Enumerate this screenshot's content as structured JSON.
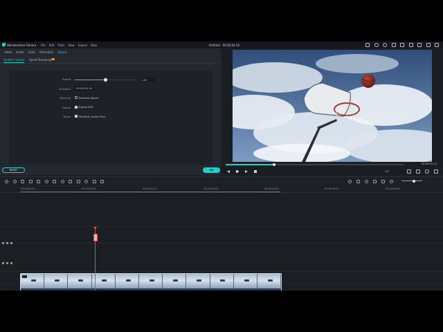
{
  "app": {
    "name": "Wondershare Filmora",
    "menus": [
      "File",
      "Edit",
      "Tools",
      "View",
      "Export",
      "Help"
    ],
    "document_title": "Untitled : 00:00:04:16"
  },
  "panel": {
    "tabs": [
      "Video",
      "Audio",
      "Color",
      "Animation",
      "Speed"
    ],
    "active_tab": "Speed",
    "subtabs": [
      "Uniform Speed",
      "Speed Ramping"
    ],
    "active_subtab": "Uniform Speed",
    "speed": {
      "label": "Speed",
      "value": "1.00",
      "level": 0.5
    },
    "duration": {
      "label": "Duration",
      "value": "00:00:04:16"
    },
    "reverse": {
      "label": "Reverse",
      "checkbox_label": "Reverse Speed",
      "checked": false
    },
    "ripple": {
      "label": "Ripple",
      "checkbox_label": "Ripple Edit",
      "checked": true
    },
    "tones": {
      "label": "Tones",
      "checkbox_label": "Maintain Audio Pitch",
      "checked": true
    },
    "reset_label": "RESET",
    "ok_label": "OK"
  },
  "preview": {
    "current_time": "00:00:01:14",
    "progress": 0.27,
    "ratio": "1/2"
  },
  "timeline": {
    "ruler_labels": [
      "00:00:00:00",
      "00:00:01:00",
      "00:00:02:00",
      "00:00:03:00",
      "00:00:04:00",
      "00:00:05:00",
      "00:00:06:00"
    ],
    "zoom_level": 0.6
  },
  "colors": {
    "accent": "#1fd2c8",
    "playhead": "#e8494c",
    "panel_bg": "#252830"
  }
}
